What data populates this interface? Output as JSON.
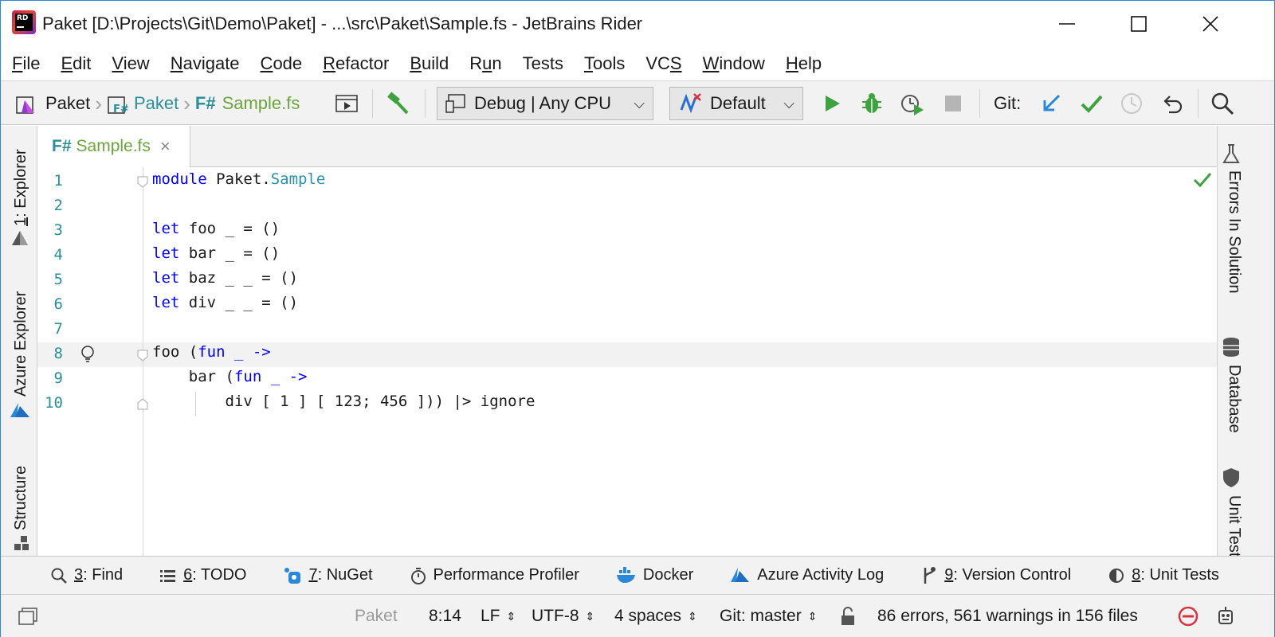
{
  "window": {
    "title": "Paket [D:\\Projects\\Git\\Demo\\Paket] - ...\\src\\Paket\\Sample.fs - JetBrains Rider",
    "logo_text": "RD",
    "minimize_icon": "minimize-icon",
    "maximize_icon": "maximize-icon",
    "close_icon": "close-icon"
  },
  "menu": [
    {
      "label": "File",
      "mnemonic": "F"
    },
    {
      "label": "Edit",
      "mnemonic": "E"
    },
    {
      "label": "View",
      "mnemonic": "V"
    },
    {
      "label": "Navigate",
      "mnemonic": "N"
    },
    {
      "label": "Code",
      "mnemonic": "C"
    },
    {
      "label": "Refactor",
      "mnemonic": "R"
    },
    {
      "label": "Build",
      "mnemonic": "B"
    },
    {
      "label": "Run",
      "mnemonic": "u"
    },
    {
      "label": "Tests",
      "mnemonic": ""
    },
    {
      "label": "Tools",
      "mnemonic": "T"
    },
    {
      "label": "VCS",
      "mnemonic": "S"
    },
    {
      "label": "Window",
      "mnemonic": "W"
    },
    {
      "label": "Help",
      "mnemonic": "H"
    }
  ],
  "toolbar": {
    "breadcrumbs": [
      "Paket",
      "Paket",
      "Sample.fs"
    ],
    "fsharp_badge": "F#",
    "configuration": "Debug | Any CPU",
    "run_target": "Default",
    "git_label": "Git:",
    "colors": {
      "run_green": "#3ea33e",
      "git_blue": "#2b88d8",
      "fsharp_teal": "#2a8f9a",
      "file_green": "#6ba53b"
    }
  },
  "tabs": [
    {
      "label": "Sample.fs",
      "badge": "F#",
      "close_icon": "close-icon"
    }
  ],
  "left_tools": [
    "1: Explorer",
    "Azure Explorer",
    "Structure"
  ],
  "right_tools": [
    "Errors In Solution",
    "Database",
    "Unit Tests"
  ],
  "editor": {
    "lines": [
      {
        "n": "1"
      },
      {
        "n": "2"
      },
      {
        "n": "3"
      },
      {
        "n": "4"
      },
      {
        "n": "5"
      },
      {
        "n": "6"
      },
      {
        "n": "7"
      },
      {
        "n": "8"
      },
      {
        "n": "9"
      },
      {
        "n": "10"
      }
    ],
    "code": {
      "l1_kw": "module",
      "l1_a": " Paket.",
      "l1_b": "Sample",
      "let": "let",
      "l3": " foo _ = ()",
      "l4": " bar _ = ()",
      "l5": " baz _ _ = ()",
      "l6": " div _ _ = ()",
      "l8_a": "foo (",
      "fun": "fun",
      "l8_b": " _ ->",
      "l9_a": "    bar (",
      "l9_b": " _ ->",
      "l10": "        div [ 1 ] [ 123; 456 ])) |> ignore"
    }
  },
  "bottom_tools": [
    {
      "label": "3: Find",
      "mnemonic": "3",
      "icon": "search-icon"
    },
    {
      "label": "6: TODO",
      "mnemonic": "6",
      "icon": "list-icon"
    },
    {
      "label": "7: NuGet",
      "mnemonic": "7",
      "icon": "nuget-icon"
    },
    {
      "label": "Performance Profiler",
      "mnemonic": "",
      "icon": "stopwatch-icon"
    },
    {
      "label": "Docker",
      "mnemonic": "",
      "icon": "docker-icon"
    },
    {
      "label": "Azure Activity Log",
      "mnemonic": "",
      "icon": "azure-icon"
    },
    {
      "label": "9: Version Control",
      "mnemonic": "9",
      "icon": "vcs-icon"
    },
    {
      "label": "8: Unit Tests",
      "mnemonic": "8",
      "icon": "unit-tests-icon"
    }
  ],
  "status": {
    "project": "Paket",
    "position": "8:14",
    "line_ending": "LF",
    "encoding": "UTF-8",
    "indent": "4 spaces",
    "git_branch": "Git: master",
    "problems": "86 errors, 561 warnings in 156 files"
  }
}
